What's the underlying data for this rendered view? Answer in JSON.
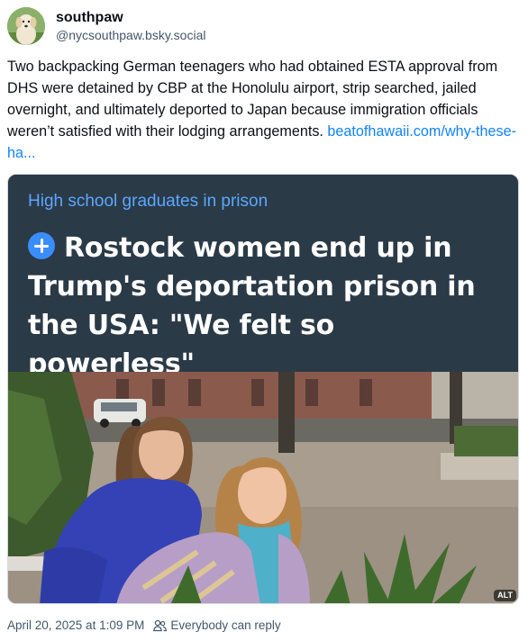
{
  "author": {
    "display_name": "southpaw",
    "handle": "@nycsouthpaw.bsky.social",
    "avatar_icon": "dog-avatar-icon"
  },
  "post": {
    "text": "Two backpacking German teenagers who had obtained ESTA approval from DHS were detained by CBP at the Honolulu airport, strip searched, jailed overnight, and ultimately deported to Japan because immigration officials weren’t satisfied with their lodging arrangements. ",
    "link_text": "beatofhawaii.com/why-these-ha..."
  },
  "embed": {
    "kicker": "High school graduates in prison",
    "headline": "Rostock women end up in Trump's deportation prison in the USA: \"We felt so powerless\"",
    "headline_icon": "plus-circle-icon",
    "image_alt_badge": "ALT"
  },
  "footer": {
    "timestamp": "April 20, 2025 at 1:09 PM",
    "reply_setting": "Everybody can reply",
    "reply_icon": "people-icon"
  },
  "colors": {
    "link": "#1083fe",
    "embed_bg": "#2b3a47",
    "kicker": "#5aa7ff",
    "muted": "#42576c"
  }
}
